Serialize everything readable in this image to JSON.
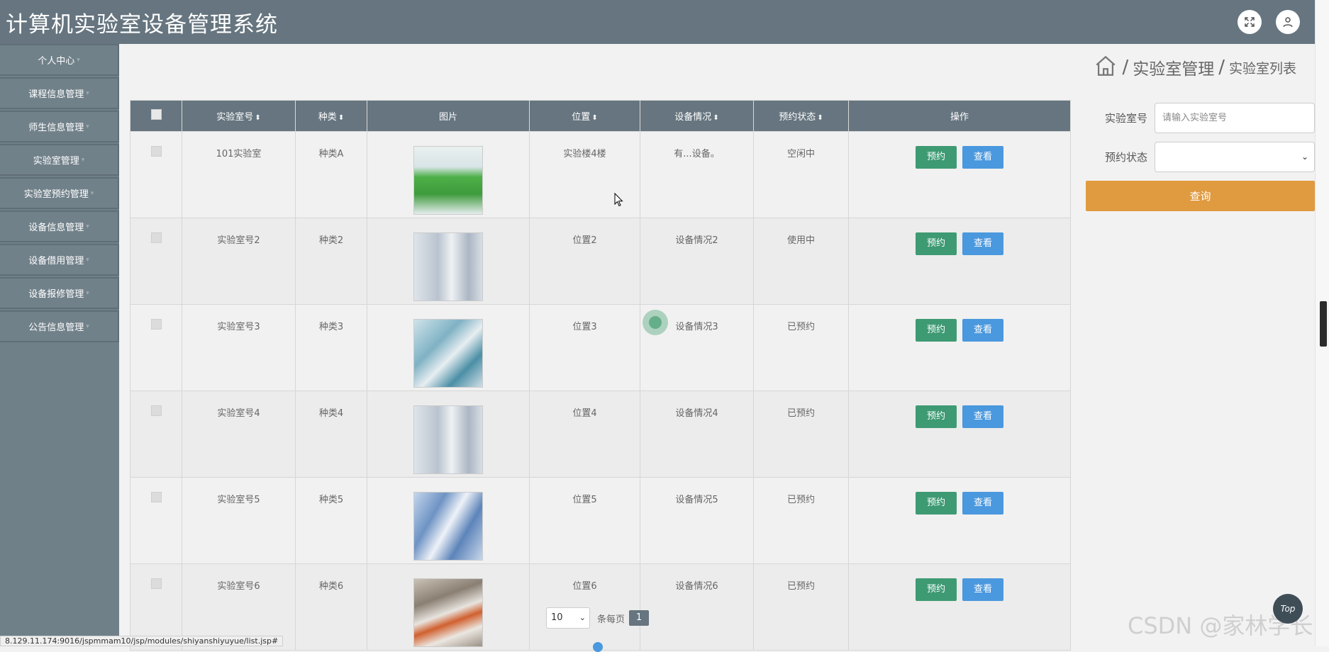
{
  "header": {
    "title": "计算机实验室设备管理系统",
    "fullscreen_icon": "fullscreen-icon",
    "user_icon": "user-icon"
  },
  "sidebar": {
    "items": [
      {
        "label": "个人中心"
      },
      {
        "label": "课程信息管理"
      },
      {
        "label": "师生信息管理"
      },
      {
        "label": "实验室管理"
      },
      {
        "label": "实验室预约管理"
      },
      {
        "label": "设备信息管理"
      },
      {
        "label": "设备借用管理"
      },
      {
        "label": "设备报修管理"
      },
      {
        "label": "公告信息管理"
      }
    ]
  },
  "breadcrumb": {
    "separator": "/",
    "level1": "实验室管理",
    "level2": "实验室列表"
  },
  "table": {
    "columns": [
      "实验室号",
      "种类",
      "图片",
      "位置",
      "设备情况",
      "预约状态",
      "操作"
    ],
    "sort_mark": "⬍",
    "rows": [
      {
        "room": "101实验室",
        "type": "种类A",
        "location": "实验楼4楼",
        "equipment": "有...设备。",
        "status": "空闲中"
      },
      {
        "room": "实验室号2",
        "type": "种类2",
        "location": "位置2",
        "equipment": "设备情况2",
        "status": "使用中"
      },
      {
        "room": "实验室号3",
        "type": "种类3",
        "location": "位置3",
        "equipment": "设备情况3",
        "status": "已预约"
      },
      {
        "room": "实验室号4",
        "type": "种类4",
        "location": "位置4",
        "equipment": "设备情况4",
        "status": "已预约"
      },
      {
        "room": "实验室号5",
        "type": "种类5",
        "location": "位置5",
        "equipment": "设备情况5",
        "status": "已预约"
      },
      {
        "room": "实验室号6",
        "type": "种类6",
        "location": "位置6",
        "equipment": "设备情况6",
        "status": "已预约"
      }
    ],
    "book_label": "预约",
    "view_label": "查看"
  },
  "search": {
    "room_label": "实验室号",
    "room_placeholder": "请输入实验室号",
    "status_label": "预约状态",
    "status_value": "",
    "query_label": "查询"
  },
  "pager": {
    "page_size": "10",
    "page_size_label": "条每页",
    "current_page": "1"
  },
  "status_url": "8.129.11.174:9016/jspmmam10/jsp/modules/shiyanshiyuyue/list.jsp#",
  "top_button": "Top",
  "watermark": "CSDN @家林学长",
  "colors": {
    "header": "#66757f",
    "sidebar": "#6f8089",
    "book": "#3e9a73",
    "view": "#4a98de",
    "query": "#e09a3f"
  }
}
